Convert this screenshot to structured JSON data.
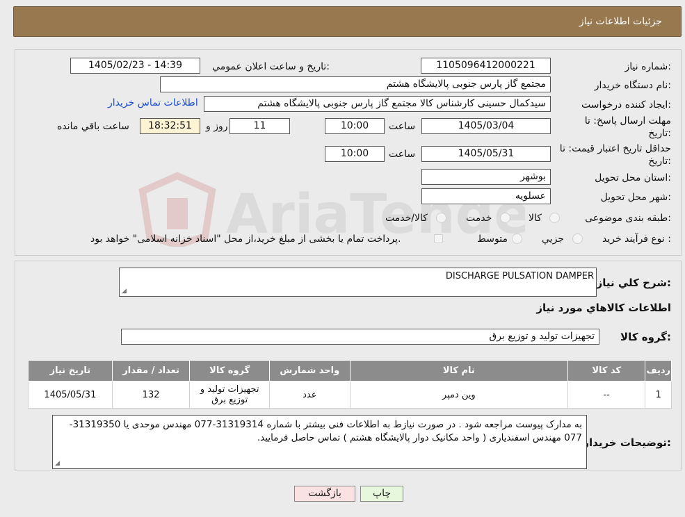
{
  "header": {
    "title": "جزئیات اطلاعات نیاز"
  },
  "form": {
    "need_number_label": "شماره نیاز:",
    "need_number": "1105096412000221",
    "announce_label": "تاریخ و ساعت اعلان عمومي:",
    "announce_value": "1405/02/23 - 14:39",
    "buyer_org_label": "نام دستگاه خریدار:",
    "buyer_org": "مجتمع گاز پارس جنوبی  پالایشگاه هشتم",
    "creator_label": "ایجاد کننده درخواست:",
    "creator": "سیدکمال حسینی کارشناس کالا مجتمع گاز پارس جنوبی  پالایشگاه هشتم",
    "contact_link": "اطلاعات تماس خریدار",
    "deadline_label_1": "مهلت ارسال پاسخ: تا",
    "deadline_label_2": "تاریخ:",
    "deadline_date": "1405/03/04",
    "time_label": "ساعت",
    "deadline_time": "10:00",
    "days_value": "11",
    "days_label": "روز و",
    "remaining_time": "18:32:51",
    "remaining_label": "ساعت باقي مانده",
    "validity_label_1": "حداقل تاریخ اعتبار قیمت: تا",
    "validity_label_2": "تاریخ:",
    "validity_date": "1405/05/31",
    "validity_time": "10:00",
    "province_label": "استان محل تحویل:",
    "province": "بوشهر",
    "city_label": "شهر محل تحویل:",
    "city": "عسلویه",
    "category_label": "طبقه بندی موضوعی:",
    "category_options": [
      "کالا",
      "خدمت",
      "کالا/خدمت"
    ],
    "process_label": "نوع فرآیند خرید :",
    "process_options": [
      "جزيي",
      "متوسط"
    ],
    "payment_note": "پرداخت تمام یا بخشی از مبلغ خرید،از محل \"اسناد خزانه اسلامی\" خواهد بود."
  },
  "details": {
    "summary_label": "شرح کلي نیاز:",
    "summary_value": "DISCHARGE PULSATION DAMPER",
    "items_title": "اطلاعات کالاهاي مورد نیاز",
    "group_label": "گروه کالا:",
    "group_value": "تجهیزات تولید و توزیع برق"
  },
  "table": {
    "headers": [
      "ردیف",
      "کد کالا",
      "نام کالا",
      "واحد شمارش",
      "گروه کالا",
      "تعداد / مقدار",
      "تاریخ نیاز"
    ],
    "rows": [
      {
        "row": "1",
        "code": "--",
        "name": "وین دمپر",
        "unit": "عدد",
        "group_line1": "تجهیزات تولید و",
        "group_line2": "توزیع برق",
        "qty": "132",
        "date": "1405/05/31"
      }
    ]
  },
  "notes": {
    "label": "توضیحات خریدار:",
    "text": "به مدارک پیوست مراجعه شود . در صورت نیازط به اطلاعات فنی بیشتر با شماره 31319314-077 مهندس موحدی یا 31319350-077 مهندس اسفندیاری ( واحد مکانیک دوار پالایشگاه هشتم ) تماس حاصل فرمایید."
  },
  "buttons": {
    "print": "چاپ",
    "back": "بازگشت"
  },
  "colors": {
    "header_bg": "#98784f",
    "table_header_bg": "#8c8c8c",
    "back_button_bg": "#fbe2e2",
    "print_button_bg": "#e6f7dc",
    "link": "#1a4fd0"
  }
}
